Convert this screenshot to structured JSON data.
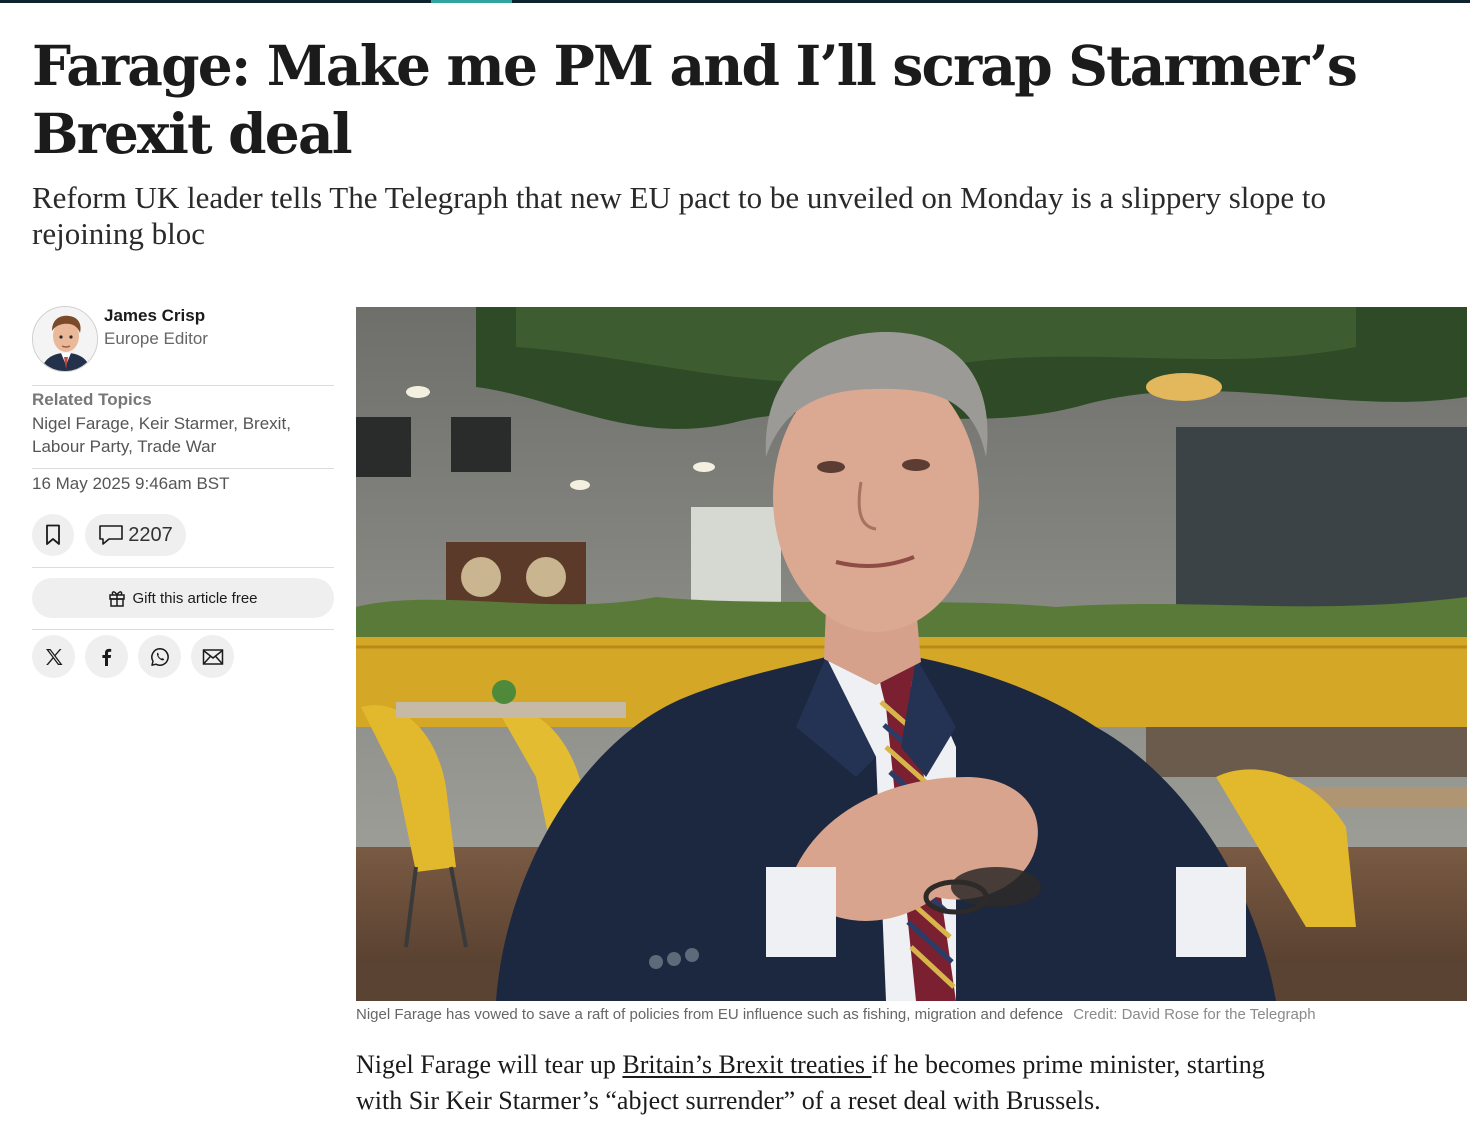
{
  "article": {
    "headline": "Farage: Make me PM and I’ll scrap Starmer’s Brexit deal",
    "standfirst": "Reform UK leader tells The Telegraph that new EU pact to be unveiled on Monday is a slippery slope to rejoining bloc"
  },
  "author": {
    "name": "James Crisp",
    "role": "Europe Editor",
    "avatar_icon": "author-portrait"
  },
  "related_topics": {
    "label": "Related Topics",
    "topics": [
      "Nigel Farage",
      "Keir Starmer",
      "Brexit",
      "Labour Party",
      "Trade War"
    ]
  },
  "published": "16 May 2025 9:46am BST",
  "actions": {
    "bookmark_icon": "bookmark-icon",
    "comments_icon": "comment-icon",
    "comments_count": "2207",
    "gift_label": "Gift this article free",
    "gift_icon": "gift-icon"
  },
  "share": [
    "x-icon",
    "facebook-icon",
    "whatsapp-icon",
    "email-icon"
  ],
  "image": {
    "caption": "Nigel Farage has vowed to save a raft of policies from EU influence such as fishing, migration and defence",
    "credit": "Credit: David Rose for the Telegraph"
  },
  "body": {
    "p1_before": "Nigel Farage will tear up ",
    "p1_link": "Britain’s Brexit treaties ",
    "p1_after": "if he becomes prime minister, starting with Sir Keir Starmer’s “abject surrender” of a reset deal with Brussels."
  },
  "colors": {
    "accent": "#2fa59d",
    "topbar": "#0f2230",
    "text": "#1b1b1b",
    "pill_bg": "#efefef"
  }
}
